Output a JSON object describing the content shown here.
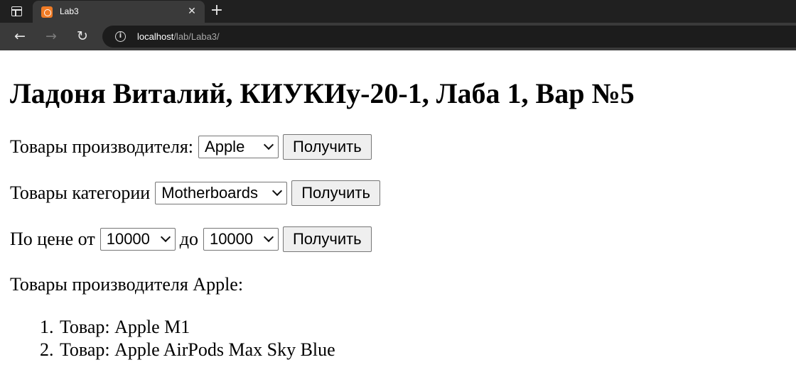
{
  "browser": {
    "tab_title": "Lab3",
    "tab_close": "✕",
    "new_tab": "+",
    "url_host": "localhost",
    "url_path": "/lab/Laba3/",
    "back_glyph": "←",
    "forward_glyph": "→",
    "reload_glyph": "↻",
    "info_glyph": "i"
  },
  "page": {
    "heading": "Ладоня Виталий, КИУКИу-20-1, Лаба 1, Вар №5",
    "manufacturer_form": {
      "label": "Товары производителя:",
      "selected": "Apple",
      "button": "Получить"
    },
    "category_form": {
      "label": "Товары категории",
      "selected": "Motherboards",
      "button": "Получить"
    },
    "price_form": {
      "label_from": "По цене от",
      "from_selected": "10000",
      "label_to": "до",
      "to_selected": "10000",
      "button": "Получить"
    },
    "results": {
      "title": "Товары производителя Apple:",
      "items": [
        {
          "num": "1.",
          "text": "Товар: Apple M1"
        },
        {
          "num": "2.",
          "text": "Товар: Apple AirPods Max Sky Blue"
        }
      ]
    }
  },
  "colors": {
    "tabbar_bg": "#202020",
    "toolbar_bg": "#3a3a3a",
    "favicon": "#f07b25",
    "page_bg": "#ffffff"
  }
}
